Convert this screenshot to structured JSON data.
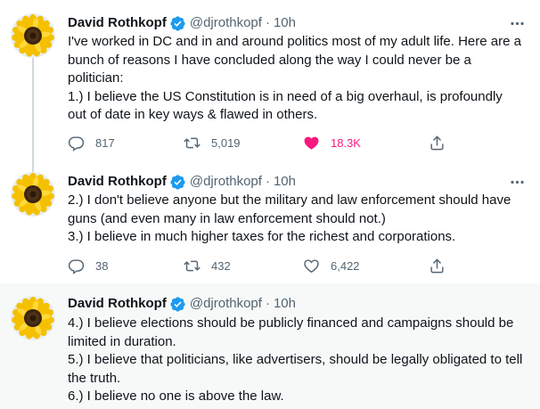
{
  "colors": {
    "like_active": "#f91880",
    "verified": "#1d9bf0",
    "secondary_text": "#536471"
  },
  "tweets": [
    {
      "name": "David Rothkopf",
      "handle": "@djrothkopf",
      "dot": "·",
      "time": "10h",
      "avatar_icon": "sunflower",
      "lines": [
        "I've worked in DC and in and around politics most of my adult life. Here are a bunch of reasons I have concluded along the way I could never be a politician:",
        "1.) I believe the US Constitution is in need of a big overhaul, is profoundly out of date in key ways & flawed in others."
      ],
      "replies": "817",
      "retweets": "5,019",
      "likes": "18.3K",
      "liked": true
    },
    {
      "name": "David Rothkopf",
      "handle": "@djrothkopf",
      "dot": "·",
      "time": "10h",
      "avatar_icon": "sunflower",
      "lines": [
        "2.) I don't believe anyone but the military and law enforcement should have guns (and even many in law enforcement should not.)",
        "3.) I believe in much higher taxes for the richest and corporations."
      ],
      "replies": "38",
      "retweets": "432",
      "likes": "6,422",
      "liked": false
    },
    {
      "name": "David Rothkopf",
      "handle": "@djrothkopf",
      "dot": "·",
      "time": "10h",
      "avatar_icon": "sunflower",
      "lines": [
        "4.) I believe elections should be publicly financed and campaigns should be limited in duration.",
        "5.) I believe that politicians, like advertisers, should be legally obligated to tell the truth.",
        "6.) I believe no one is above the law."
      ]
    }
  ]
}
